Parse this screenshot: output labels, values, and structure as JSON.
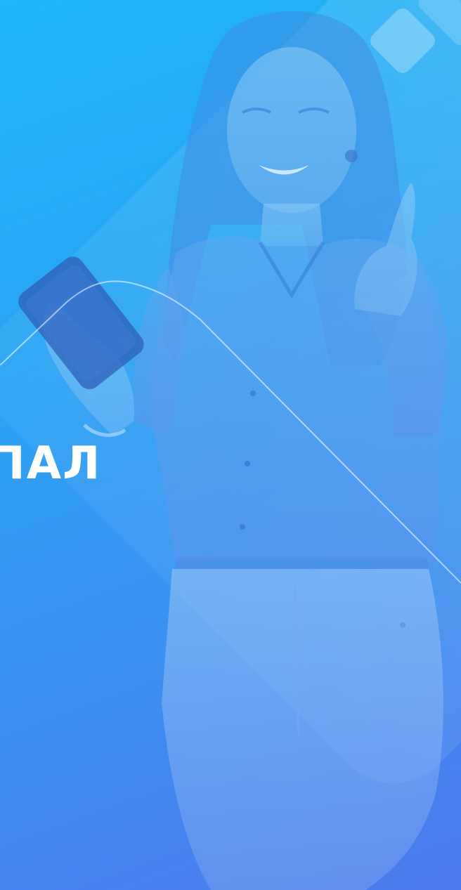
{
  "banner": {
    "headline": "ПАЛ"
  },
  "colors": {
    "gradient_top": "#1eb6f7",
    "gradient_bottom": "#4e79ec",
    "headline": "#ffffff"
  },
  "illustration": {
    "subject": "smiling-woman-with-phone-photo"
  }
}
